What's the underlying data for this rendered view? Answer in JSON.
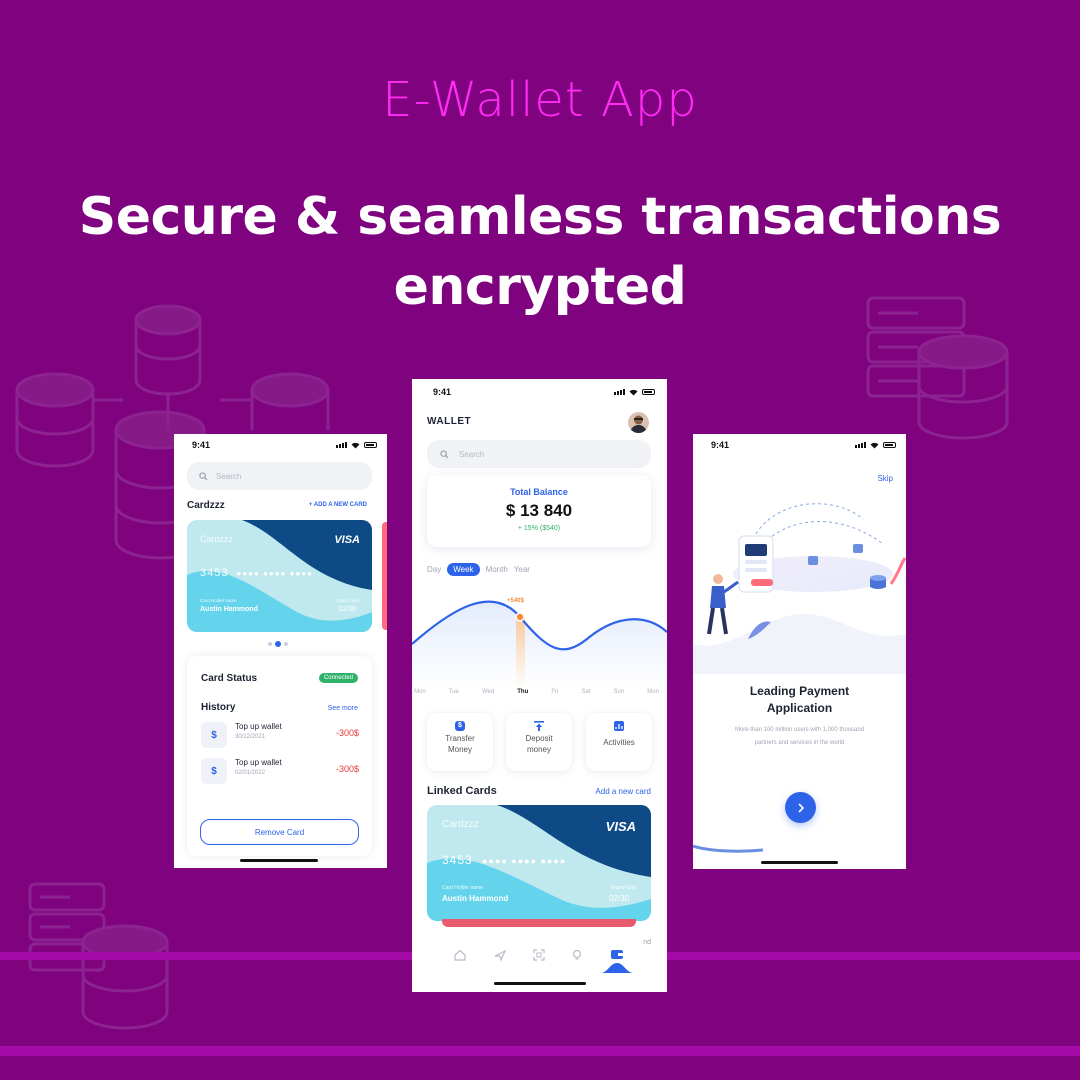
{
  "hero": {
    "subtitle": "E-Wallet App",
    "title_line1": "Secure & seamless transactions",
    "title_line2": "encrypted"
  },
  "colors": {
    "background": "#7f027f",
    "subtitle": "#ff2bf2",
    "accent_blue": "#2d63e8",
    "card_dark": "#0e4a86",
    "card_light": "#63d4ec",
    "negative": "#e53935",
    "positive": "#2fb26a"
  },
  "left_phone": {
    "status_time": "9:41",
    "search_placeholder": "Search",
    "section_title": "Cardzzz",
    "add_card_link": "+ ADD A NEW CARD",
    "card": {
      "brand_label": "Cardzzz",
      "network": "VISA",
      "number_start": "3453",
      "number_masked": "●●●● ●●●● ●●●●",
      "holder_label": "Card Holder name",
      "holder_name": "Austin Hammond",
      "expiry_label": "Expiry date",
      "expiry": "02/30"
    },
    "card_status_title": "Card Status",
    "status_badge": "Connected",
    "history_title": "History",
    "see_more": "See more",
    "history": [
      {
        "title": "Top up wallet",
        "date": "30/12/2021",
        "amount": "-300$"
      },
      {
        "title": "Top up wallet",
        "date": "02/01/2022",
        "amount": "-300$"
      }
    ],
    "remove_button": "Remove Card"
  },
  "center_phone": {
    "status_time": "9:41",
    "header_title": "WALLET",
    "search_placeholder": "Search",
    "balance_label": "Total Balance",
    "balance_value": "$ 13 840",
    "balance_change": "+ 15% ($540)",
    "periods": [
      "Day",
      "Week",
      "Month",
      "Year"
    ],
    "active_period": "Week",
    "chart_tooltip": "+540$",
    "weekdays": [
      "Mon",
      "Tue",
      "Wed",
      "Thu",
      "Fri",
      "Sat",
      "Sun",
      "Mon"
    ],
    "active_day": "Thu",
    "actions": [
      {
        "line1": "Transfer",
        "line2": "Money",
        "icon": "dollar-icon"
      },
      {
        "line1": "Deposit",
        "line2": "money",
        "icon": "upload-icon"
      },
      {
        "line1": "Activities",
        "line2": "",
        "icon": "chart-icon"
      }
    ],
    "linked_title": "Linked Cards",
    "add_card_link": "Add a new card",
    "card": {
      "brand_label": "Cardzzz",
      "network": "VISA",
      "number_start": "3453",
      "number_masked": "●●●● ●●●● ●●●●",
      "holder_label": "Card Holder name",
      "holder_name": "Austin Hammond",
      "expiry_label": "Expiry date",
      "expiry": "02/30"
    },
    "nav_partial_text": "nd",
    "nav_icons": [
      "home-icon",
      "plane-icon",
      "scan-icon",
      "bulb-icon",
      "wallet-icon"
    ]
  },
  "right_phone": {
    "status_time": "9:41",
    "skip": "Skip",
    "title_line1": "Leading Payment",
    "title_line2": "Application",
    "desc_line1": "More than 100 million users with 1,000 thousand",
    "desc_line2": "partners and services in the world",
    "next_icon": "chevron-right-icon"
  }
}
